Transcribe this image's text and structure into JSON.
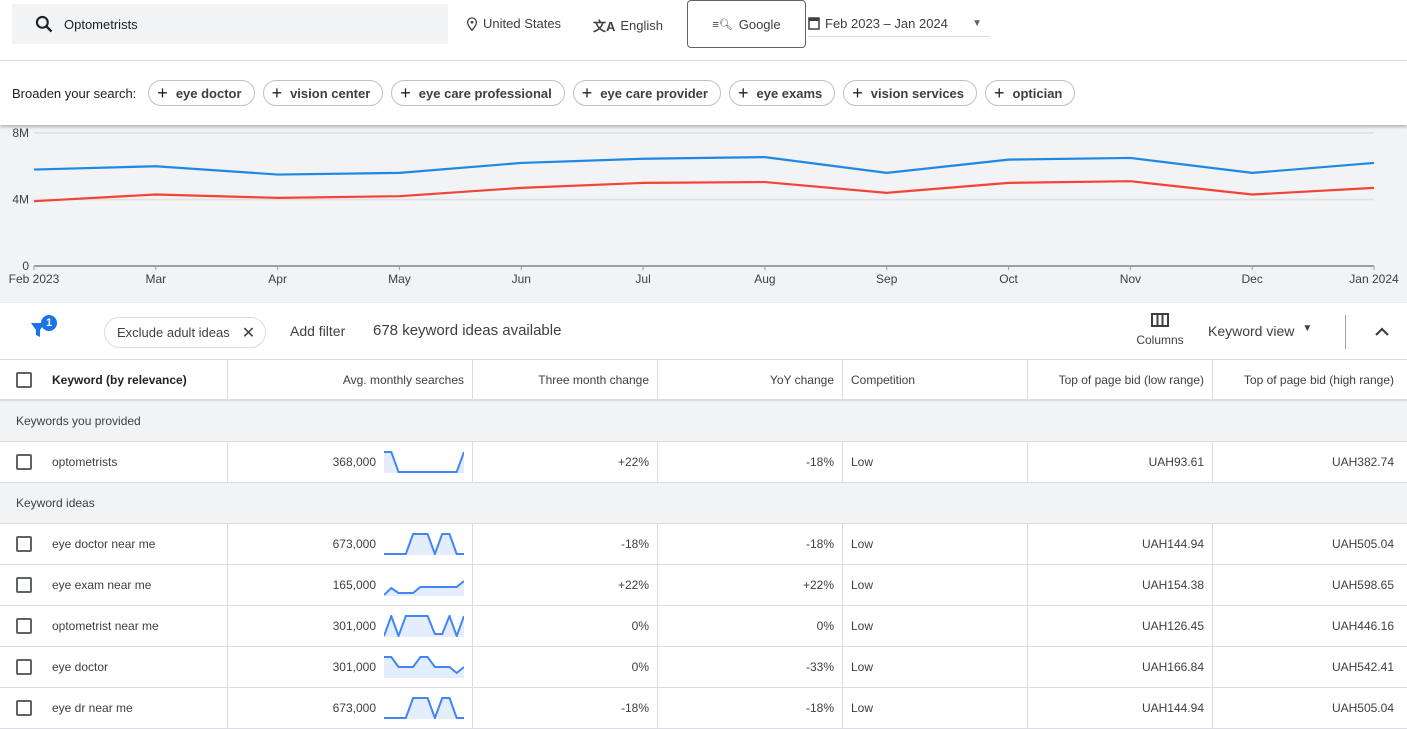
{
  "header": {
    "search_value": "Optometrists",
    "location": "United States",
    "language": "English",
    "network": "Google",
    "date_range": "Feb 2023 – Jan 2024"
  },
  "broaden": {
    "label": "Broaden your search:",
    "chips": [
      "eye doctor",
      "vision center",
      "eye care professional",
      "eye care provider",
      "eye exams",
      "vision services",
      "optician"
    ]
  },
  "chart_data": {
    "type": "line",
    "x": [
      "Feb 2023",
      "Mar",
      "Apr",
      "May",
      "Jun",
      "Jul",
      "Aug",
      "Sep",
      "Oct",
      "Nov",
      "Dec",
      "Jan 2024"
    ],
    "yticks": [
      "0",
      "4M",
      "8M"
    ],
    "ylim": [
      0,
      8000000
    ],
    "grid": true,
    "series": [
      {
        "color": "#1e88e5",
        "values": [
          5800000,
          6000000,
          5500000,
          5600000,
          6200000,
          6450000,
          6550000,
          5600000,
          6400000,
          6500000,
          5600000,
          6200000
        ]
      },
      {
        "color": "#f44336",
        "values": [
          3900000,
          4300000,
          4100000,
          4200000,
          4700000,
          5000000,
          5050000,
          4400000,
          5000000,
          5100000,
          4300000,
          4700000
        ]
      }
    ]
  },
  "filters": {
    "badge_count": "1",
    "chip": "Exclude adult ideas",
    "add_filter": "Add filter",
    "count_text": "678 keyword ideas available",
    "columns_label": "Columns",
    "view_label": "Keyword view"
  },
  "table": {
    "headers": [
      "Keyword (by relevance)",
      "Avg. monthly searches",
      "Three month change",
      "YoY change",
      "Competition",
      "Top of page bid (low range)",
      "Top of page bid (high range)"
    ],
    "group_provided": "Keywords you provided",
    "group_ideas": "Keyword ideas",
    "provided": [
      {
        "keyword": "optometrists",
        "avg": "368,000",
        "three": "+22%",
        "yoy": "-18%",
        "comp": "Low",
        "low": "UAH93.61",
        "high": "UAH382.74",
        "spark": [
          1,
          1,
          0,
          0,
          0,
          0,
          0,
          0,
          0,
          0,
          0,
          1
        ]
      }
    ],
    "ideas": [
      {
        "keyword": "eye doctor near me",
        "avg": "673,000",
        "three": "-18%",
        "yoy": "-18%",
        "comp": "Low",
        "low": "UAH144.94",
        "high": "UAH505.04",
        "spark": [
          0,
          0,
          0,
          0,
          1,
          1,
          1,
          0,
          1,
          1,
          0,
          0
        ]
      },
      {
        "keyword": "eye exam near me",
        "avg": "165,000",
        "three": "+22%",
        "yoy": "+22%",
        "comp": "Low",
        "low": "UAH154.38",
        "high": "UAH598.65",
        "spark": [
          0,
          0.35,
          0.1,
          0.1,
          0.1,
          0.4,
          0.4,
          0.4,
          0.4,
          0.4,
          0.4,
          0.7
        ]
      },
      {
        "keyword": "optometrist near me",
        "avg": "301,000",
        "three": "0%",
        "yoy": "0%",
        "comp": "Low",
        "low": "UAH126.45",
        "high": "UAH446.16",
        "spark": [
          0,
          1,
          0,
          1,
          1,
          1,
          1,
          0.1,
          0.1,
          1,
          0,
          1
        ]
      },
      {
        "keyword": "eye doctor",
        "avg": "301,000",
        "three": "0%",
        "yoy": "-33%",
        "comp": "Low",
        "low": "UAH166.84",
        "high": "UAH542.41",
        "spark": [
          1,
          1,
          0.5,
          0.5,
          0.5,
          1,
          1,
          0.5,
          0.5,
          0.5,
          0.2,
          0.5
        ]
      },
      {
        "keyword": "eye dr near me",
        "avg": "673,000",
        "three": "-18%",
        "yoy": "-18%",
        "comp": "Low",
        "low": "UAH144.94",
        "high": "UAH505.04",
        "spark": [
          0,
          0,
          0,
          0,
          1,
          1,
          1,
          0,
          1,
          1,
          0,
          0
        ]
      }
    ]
  }
}
